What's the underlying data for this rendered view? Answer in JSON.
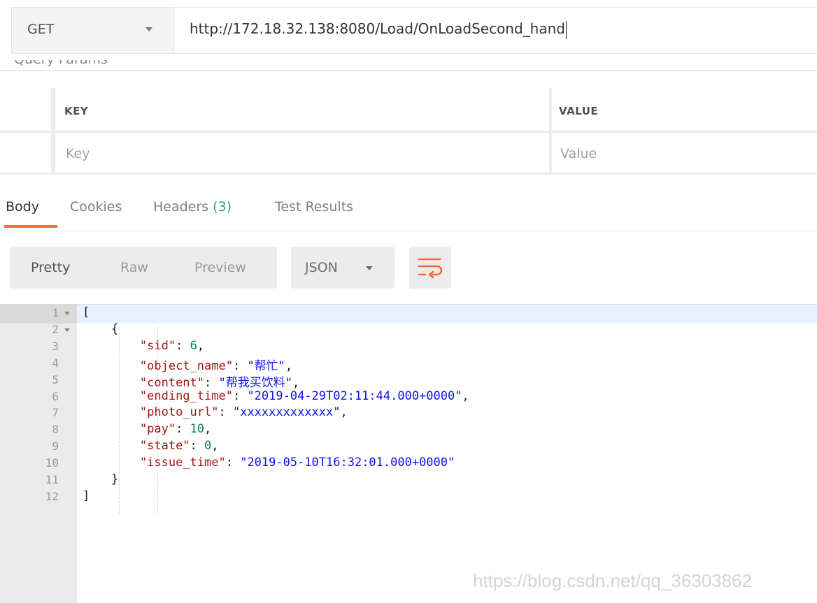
{
  "request": {
    "method": "GET",
    "url": "http://172.18.32.138:8080/Load/OnLoadSecond_hand"
  },
  "query_params": {
    "section_label": "Query Params",
    "columns": [
      "KEY",
      "VALUE"
    ],
    "placeholders": {
      "key": "Key",
      "value": "Value"
    }
  },
  "response_tabs": [
    {
      "label": "Body"
    },
    {
      "label": "Cookies"
    },
    {
      "label": "Headers",
      "count": "(3)"
    },
    {
      "label": "Test Results"
    }
  ],
  "view_modes": [
    "Pretty",
    "Raw",
    "Preview"
  ],
  "format": "JSON",
  "wrap_icon": "wrap-lines-icon",
  "code_lines": [
    {
      "n": "1",
      "text": "["
    },
    {
      "n": "2",
      "text": "    {"
    },
    {
      "n": "3",
      "key": "\"sid\"",
      "value": "6",
      "type": "number",
      "comma": true
    },
    {
      "n": "4",
      "key": "\"object_name\"",
      "value": "\"帮忙\"",
      "type": "string",
      "comma": true
    },
    {
      "n": "5",
      "key": "\"content\"",
      "value": "\"帮我买饮料\"",
      "type": "string",
      "comma": true
    },
    {
      "n": "6",
      "key": "\"ending_time\"",
      "value": "\"2019-04-29T02:11:44.000+0000\"",
      "type": "string",
      "comma": true
    },
    {
      "n": "7",
      "key": "\"photo_url\"",
      "value": "\"xxxxxxxxxxxxx\"",
      "type": "string",
      "comma": true
    },
    {
      "n": "8",
      "key": "\"pay\"",
      "value": "10",
      "type": "number",
      "comma": true
    },
    {
      "n": "9",
      "key": "\"state\"",
      "value": "0",
      "type": "number",
      "comma": true
    },
    {
      "n": "10",
      "key": "\"issue_time\"",
      "value": "\"2019-05-10T16:32:01.000+0000\"",
      "type": "string",
      "comma": false
    },
    {
      "n": "11",
      "text": "    }"
    },
    {
      "n": "12",
      "text": "]"
    }
  ],
  "watermark": "https://blog.csdn.net/qq_36303862",
  "colors": {
    "accent": "#f26b3a",
    "count_green": "#27ae60",
    "json_key": "#a31515",
    "json_string": "#1010ee",
    "json_number": "#098658"
  }
}
